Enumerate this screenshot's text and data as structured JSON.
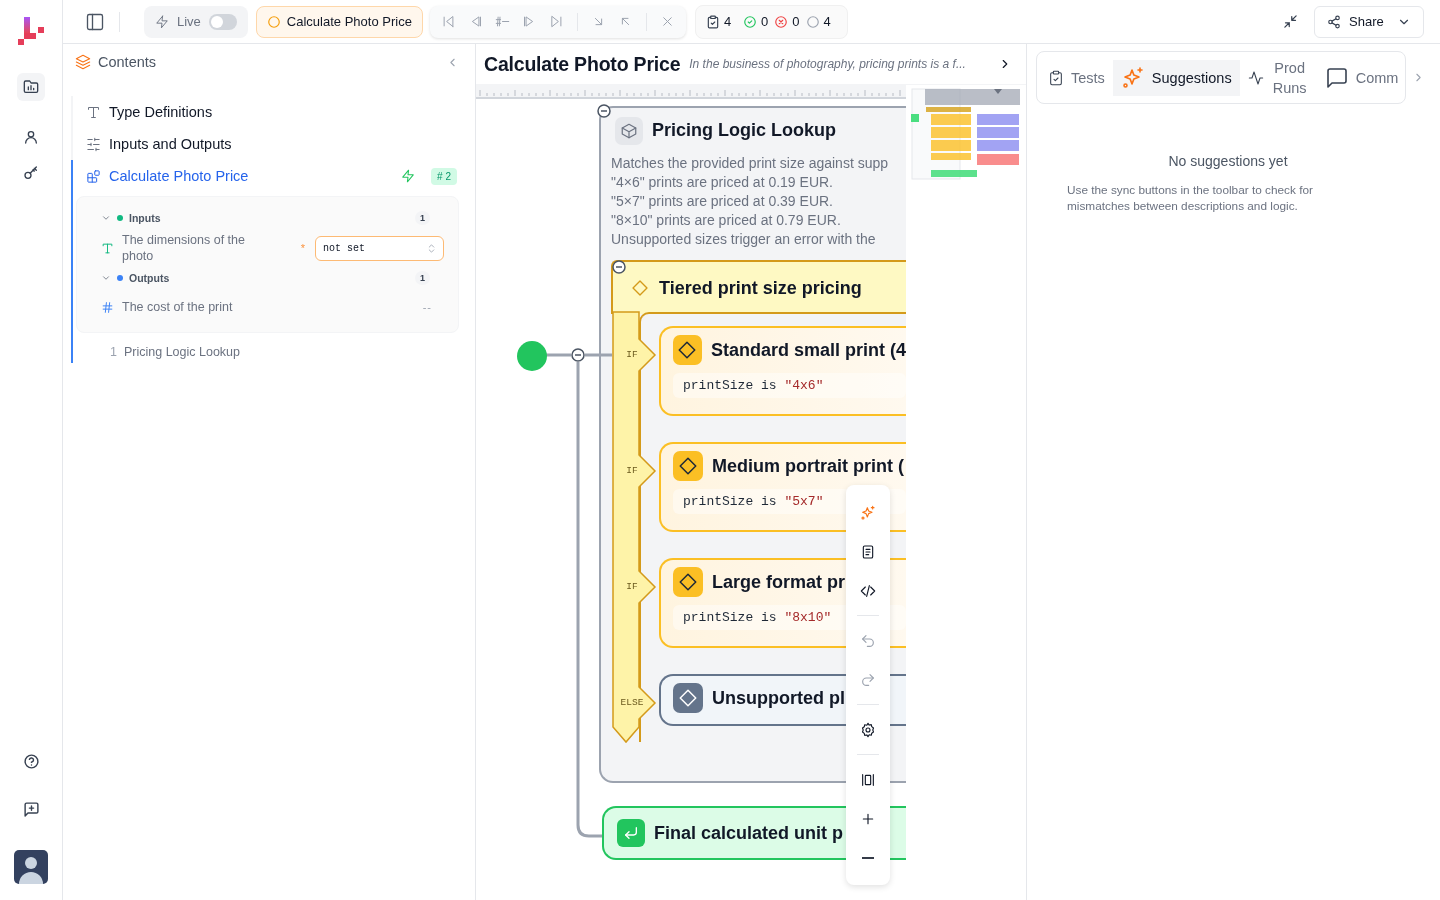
{
  "topbar": {
    "live": {
      "label": "Live",
      "on": false
    },
    "function_chip": "Calculate Photo Price",
    "stats": [
      {
        "kind": "total",
        "value": "4"
      },
      {
        "kind": "passed",
        "value": "0"
      },
      {
        "kind": "failed",
        "value": "0"
      },
      {
        "kind": "pending",
        "value": "4"
      }
    ],
    "share": "Share"
  },
  "sidebar": {
    "title": "Contents",
    "items": [
      {
        "kind": "types",
        "label": "Type Definitions",
        "selected": false
      },
      {
        "kind": "io",
        "label": "Inputs and Outputs",
        "selected": false
      },
      {
        "kind": "function",
        "label": "Calculate Photo Price",
        "selected": true,
        "badge": "# 2"
      }
    ],
    "inputs": {
      "label": "Inputs",
      "count": "1",
      "expanded": true,
      "fields": [
        {
          "kind": "text",
          "label": "The dimensions of the photo",
          "required_mark": "*",
          "placeholder": "not set"
        }
      ]
    },
    "outputs": {
      "label": "Outputs",
      "count": "1",
      "expanded": true,
      "fields": [
        {
          "kind": "number",
          "label": "The cost of the print",
          "value": "--"
        }
      ]
    },
    "steps": [
      {
        "number": "1",
        "label": "Pricing Logic Lookup"
      }
    ]
  },
  "canvas": {
    "title": "Calculate Photo Price",
    "description": "In the business of photography, pricing prints is a f...",
    "group": {
      "title": "Pricing Logic Lookup",
      "expanded": true,
      "description": [
        "Matches the provided print size against supp",
        "\"4×6\" prints are priced at 0.19 EUR.",
        "\"5×7\" prints are priced at 0.39 EUR.",
        "\"8×10\" prints are priced at 0.79 EUR.",
        "Unsupported sizes trigger an error with the"
      ],
      "decision": {
        "title": "Tiered print size pricing",
        "expanded": true,
        "branches": [
          {
            "kind": "if",
            "label": "IF",
            "title": "Standard small print (4",
            "condition": {
              "field": "printSize",
              "op": "is",
              "value": "\"4x6\""
            }
          },
          {
            "kind": "if",
            "label": "IF",
            "title": "Medium portrait print (",
            "condition": {
              "field": "printSize",
              "op": "is",
              "value": "\"5x7\""
            }
          },
          {
            "kind": "if",
            "label": "IF",
            "title": "Large format pr",
            "condition": {
              "field": "printSize",
              "op": "is",
              "value": "\"8x10\""
            }
          },
          {
            "kind": "else",
            "label": "ELSE",
            "title": "Unsupported pl"
          }
        ]
      }
    },
    "result": {
      "title": "Final calculated unit p"
    }
  },
  "right_panel": {
    "tabs": [
      {
        "kind": "tests",
        "label": "Tests",
        "selected": false
      },
      {
        "kind": "suggestions",
        "label": "Suggestions",
        "selected": true
      },
      {
        "kind": "runs",
        "label": "Prod Runs",
        "selected": false
      },
      {
        "kind": "comments",
        "label": "Comm",
        "selected": false
      }
    ],
    "empty_title": "No suggestions yet",
    "empty_text": "Use the sync buttons in the toolbar to check for mismatches between descriptions and logic."
  }
}
